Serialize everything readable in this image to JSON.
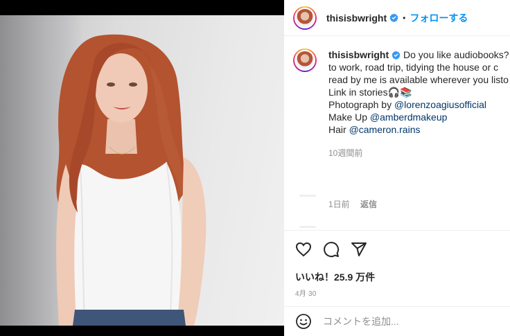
{
  "post": {
    "username": "thisisbwright",
    "follow_label": "フォローする",
    "dot": "•"
  },
  "caption": {
    "username": "thisisbwright",
    "lines": [
      "Do you like audiobooks?",
      "to work, road trip, tidying the house or c",
      "read by me is available wherever you listo",
      "Link in stories🎧📚"
    ],
    "photo_prefix": "Photograph by ",
    "photo_mention": "@lorenzoagiusofficial",
    "makeup_prefix": "Make Up ",
    "makeup_mention": "@amberdmakeup",
    "hair_prefix": "Hair ",
    "hair_mention": "@cameron.rains",
    "time": "10週間前"
  },
  "comment": {
    "time": "1日前",
    "reply": "返信"
  },
  "actions": {
    "likes": "いいね！25.9 万件",
    "date": "4月 30"
  },
  "add_comment": {
    "placeholder": "コメントを追加..."
  },
  "colors": {
    "accent": "#0095f6",
    "mention": "#00376b",
    "muted": "#8e8e8e",
    "verified": "#3897f0"
  }
}
